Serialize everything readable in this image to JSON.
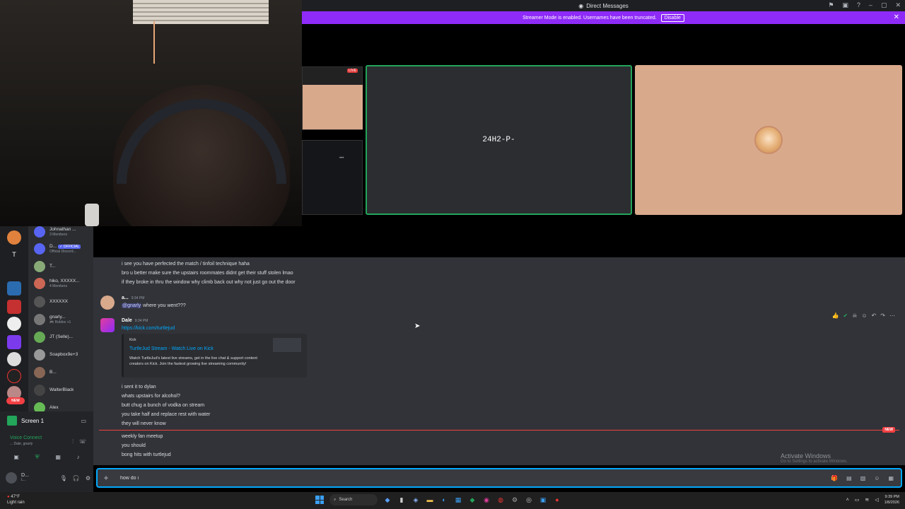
{
  "titlebar": {
    "title": "Direct Messages"
  },
  "banner": {
    "text": "Streamer Mode is enabled. Usernames have been truncated.",
    "disable": "Disable"
  },
  "call": {
    "live_label": "LIVE",
    "tile_name": "24H2-P-"
  },
  "rail": {
    "new_label": "NEW",
    "t_label": "T"
  },
  "dms": [
    {
      "name": "Johnathan ...",
      "sub": "3 Members"
    },
    {
      "name": "D...",
      "badge": "✓ OFFICIAL",
      "sub": "Official Discord..."
    },
    {
      "name": "T...",
      "sub": ""
    },
    {
      "name": "hiko, XXXXX...",
      "sub": "4 Members"
    },
    {
      "name": "XXXXXX",
      "sub": ""
    },
    {
      "name": "gnarly...",
      "sub": "🎮 Roblox +1"
    },
    {
      "name": "JT (Selle)...",
      "sub": ""
    },
    {
      "name": "Soapbox9e+3",
      "sub": ""
    },
    {
      "name": "B...",
      "sub": ""
    },
    {
      "name": "WalterBlack",
      "sub": ""
    },
    {
      "name": "Alex",
      "sub": ""
    }
  ],
  "panel": {
    "screen": "Screen 1",
    "voice": "Voice Connect",
    "voice_sub": "... Dale, gnarly",
    "user": "D...",
    "user_sub": "L..."
  },
  "chat": {
    "lines_top": [
      "i see you have perfected the match / tinfoil technique haha",
      "bro u better make sure the upstairs roommates didnt get their stuff stolen lmao",
      "if they broke in thru the window why climb back out why not just go out the door"
    ],
    "msg2_author": "a...",
    "msg2_ts": "9:34 PM",
    "msg2_mention": "@gnarly",
    "msg2_text": " where you went???",
    "msg3_author": "Dale",
    "msg3_ts": "9:34 PM",
    "msg3_link": "https://kick.com/turtlejud",
    "embed": {
      "provider": "Kick",
      "title": "TurtleJud Stream - Watch Live on Kick",
      "desc": "Watch TurtleJud's latest live streams, get in the live chat & support content creators on Kick. Join the fastest growing live streaming community!"
    },
    "lines_mid": [
      "i sent it to dylan",
      "whats upstairs for alcohol?",
      "butt chug a bunch of vodka on stream",
      "you take half and replace rest with water",
      "they will never know"
    ],
    "new_label": "NEW",
    "lines_bot": [
      "weekly fan meetup",
      "you should",
      "bong hits with turtlejud"
    ],
    "activate_title": "Activate Windows",
    "activate_sub": "Go to Settings to activate Windows."
  },
  "composer": {
    "value": "how do i"
  },
  "taskbar": {
    "weather_temp": "47°F",
    "weather_sub": "Light rain",
    "search": "Search",
    "time": "9:39 PM",
    "date": "1/8/2026"
  }
}
